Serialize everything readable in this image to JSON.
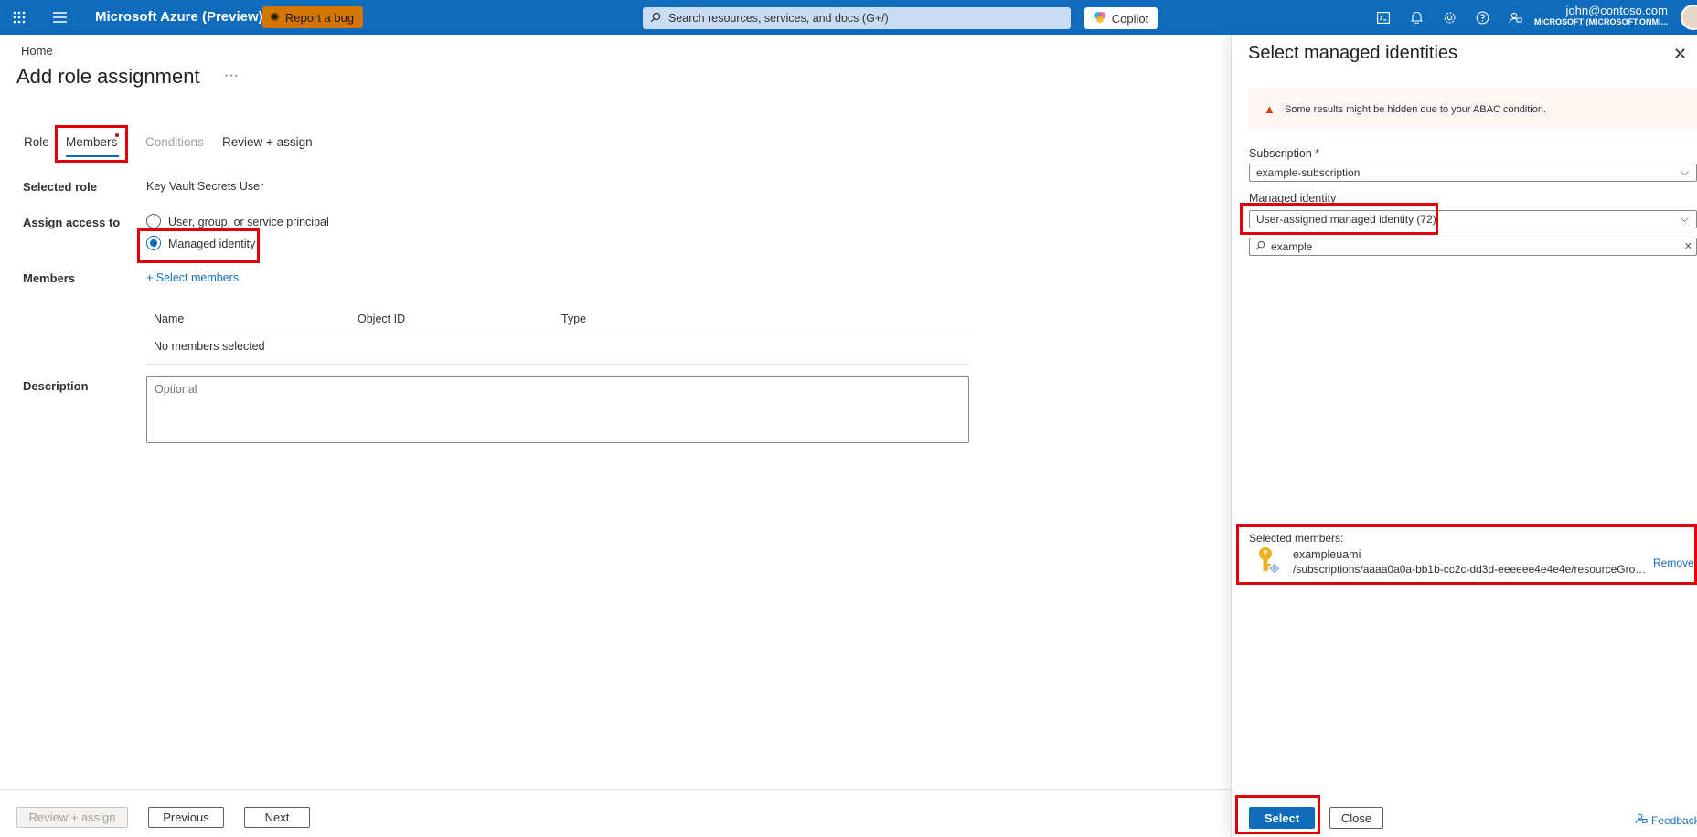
{
  "topbar": {
    "brand": "Microsoft Azure (Preview)",
    "report_bug": "Report a bug",
    "search_placeholder": "Search resources, services, and docs (G+/)",
    "copilot": "Copilot",
    "user_email": "john@contoso.com",
    "user_org": "MICROSOFT (MICROSOFT.ONMI..."
  },
  "breadcrumb": "Home",
  "page": {
    "title": "Add role assignment",
    "more": "···"
  },
  "tabs": [
    "Role",
    "Members",
    "Conditions",
    "Review + assign"
  ],
  "form": {
    "selected_role_label": "Selected role",
    "selected_role_value": "Key Vault Secrets User",
    "assign_access_label": "Assign access to",
    "option_user": "User, group, or service principal",
    "option_managed": "Managed identity",
    "members_label": "Members",
    "select_members_link": "+ Select members",
    "columns": [
      "Name",
      "Object ID",
      "Type"
    ],
    "empty_text": "No members selected",
    "description_label": "Description",
    "description_placeholder": "Optional"
  },
  "footer": {
    "review_assign": "Review + assign",
    "previous": "Previous",
    "next": "Next"
  },
  "panel": {
    "title": "Select managed identities",
    "warning": "Some results might be hidden due to your ABAC condition.",
    "subscription_label": "Subscription",
    "subscription_required": "*",
    "subscription_value": "example-subscription",
    "managed_identity_label": "Managed identity",
    "managed_identity_value": "User-assigned managed identity (72)",
    "search_value": "example",
    "selected_members_label": "Selected members:",
    "member_name": "exampleuami",
    "member_path": "/subscriptions/aaaa0a0a-bb1b-cc2c-dd3d-eeeeee4e4e4e/resourceGroups...",
    "remove": "Remove",
    "select_button": "Select",
    "close_button": "Close",
    "feedback": "Feedback"
  },
  "colors": {
    "accent": "#0f6cbd",
    "highlight": "#e3000b",
    "bug_button": "#d47500"
  }
}
